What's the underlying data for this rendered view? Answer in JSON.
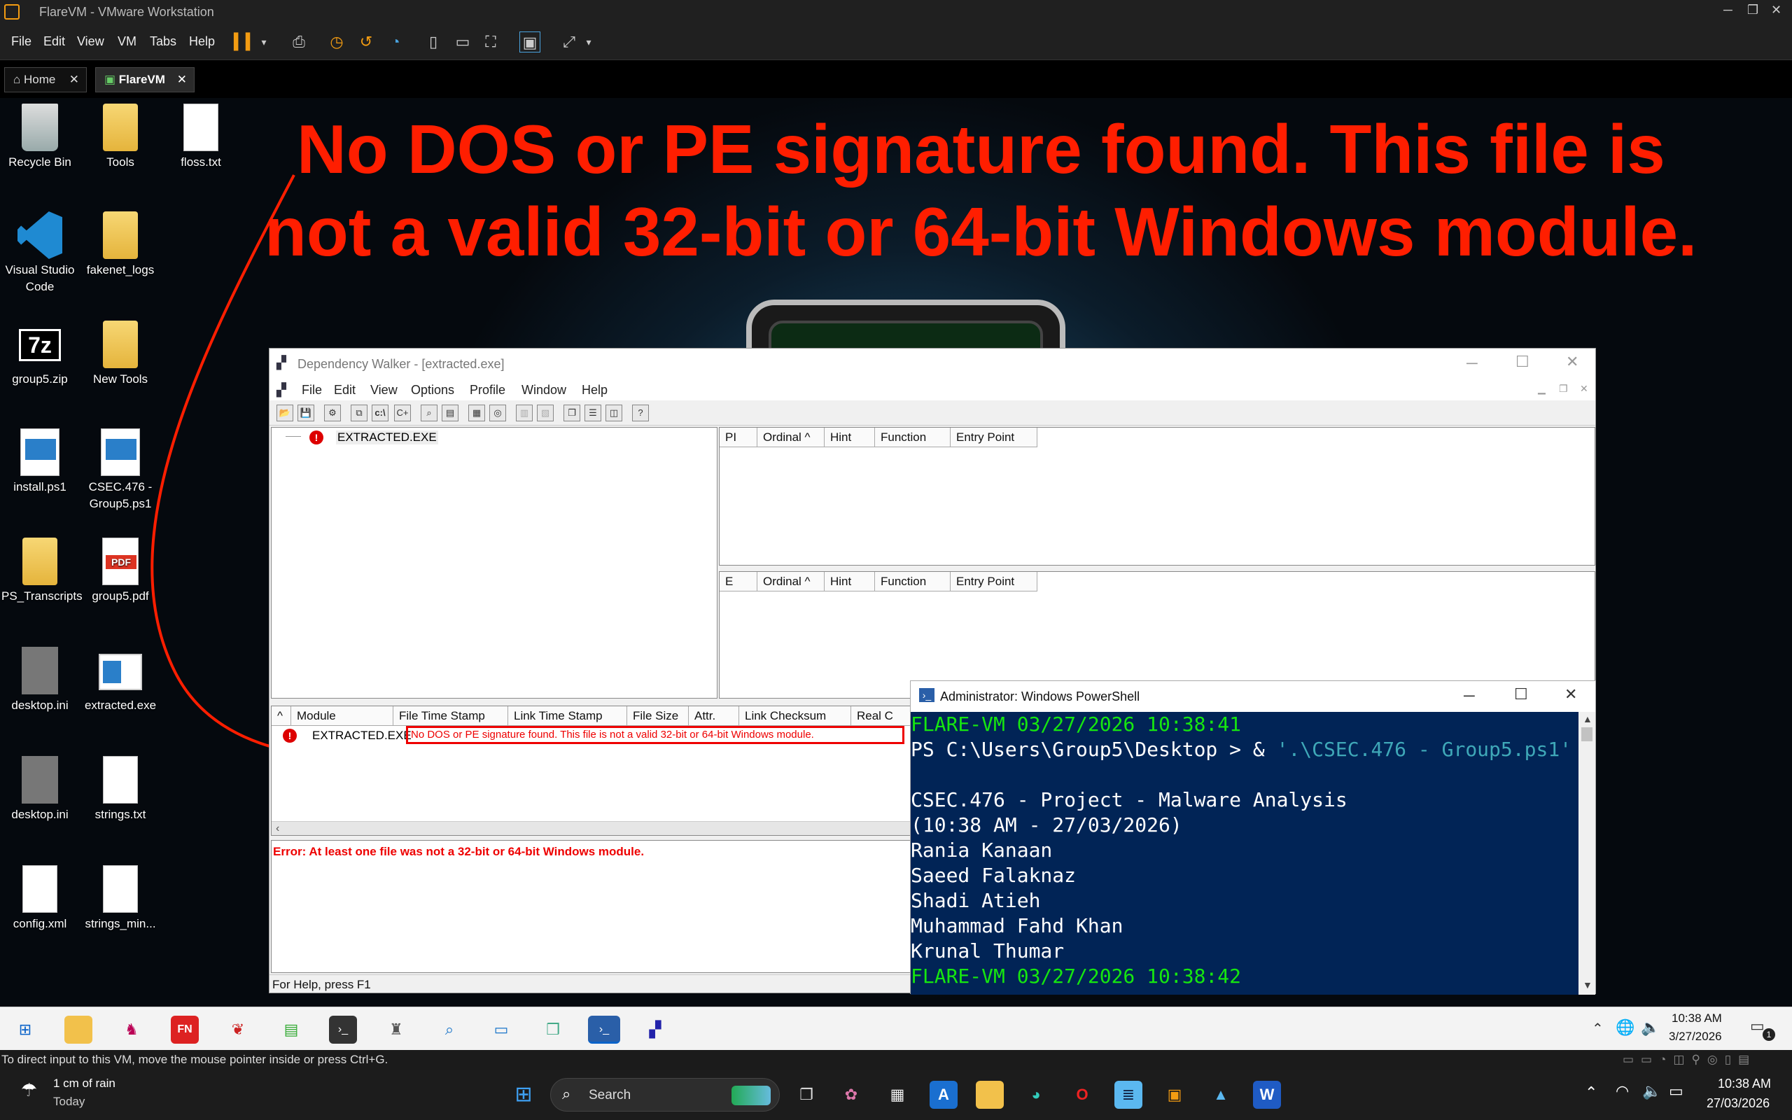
{
  "vm_window": {
    "title": "FlareVM - VMware Workstation",
    "menu": [
      "File",
      "Edit",
      "View",
      "VM",
      "Tabs",
      "Help"
    ],
    "tabs": [
      {
        "label": "Home"
      },
      {
        "label": "FlareVM"
      }
    ],
    "status_text": "To direct input to this VM, move the mouse pointer inside or press Ctrl+G."
  },
  "desktop_icons": [
    {
      "label": "Recycle Bin"
    },
    {
      "label": "Tools"
    },
    {
      "label": "floss.txt"
    },
    {
      "label": "Visual Studio Code"
    },
    {
      "label": "fakenet_logs"
    },
    {
      "label": "group5.zip"
    },
    {
      "label": "New Tools"
    },
    {
      "label": "install.ps1"
    },
    {
      "label": "CSEC.476 - Group5.ps1"
    },
    {
      "label": "PS_Transcripts"
    },
    {
      "label": "group5.pdf"
    },
    {
      "label": "desktop.ini"
    },
    {
      "label": "extracted.exe"
    },
    {
      "label": "desktop.ini"
    },
    {
      "label": "strings.txt"
    },
    {
      "label": "config.xml"
    },
    {
      "label": "strings_min..."
    }
  ],
  "annotation": {
    "line1": "No DOS or PE signature found. This file is",
    "line2": "not a valid 32-bit or 64-bit Windows module.",
    "color": "#ff1e00"
  },
  "depwalker": {
    "title": "Dependency Walker - [extracted.exe]",
    "menu": [
      "File",
      "Edit",
      "View",
      "Options",
      "Profile",
      "Window",
      "Help"
    ],
    "tree_root": "EXTRACTED.EXE",
    "import_headers": [
      "PI",
      "Ordinal ^",
      "Hint",
      "Function",
      "Entry Point"
    ],
    "export_headers": [
      "E",
      "Ordinal ^",
      "Hint",
      "Function",
      "Entry Point"
    ],
    "module_headers": [
      "^",
      "Module",
      "File Time Stamp",
      "Link Time Stamp",
      "File Size",
      "Attr.",
      "Link Checksum",
      "Real C"
    ],
    "module_row": {
      "module": "EXTRACTED.EXE",
      "message": "No DOS or PE signature found. This file is not a valid 32-bit or 64-bit Windows module."
    },
    "log_error": "Error: At least one file was not a 32-bit or 64-bit Windows module.",
    "status": "For Help, press F1",
    "toolbar_cmd": "c:\\"
  },
  "powershell": {
    "title": "Administrator: Windows PowerShell",
    "prompt_time1": "FLARE-VM 03/27/2026 10:38:41",
    "prompt_cmd": "PS C:\\Users\\Group5\\Desktop > & ",
    "prompt_arg": "'.\\CSEC.476 - Group5.ps1'",
    "output": [
      "CSEC.476 - Project - Malware Analysis",
      "(10:38 AM - 27/03/2026)",
      "Rania Kanaan",
      "Saeed Falaknaz",
      "Shadi Atieh",
      "Muhammad Fahd Khan",
      "Krunal Thumar"
    ],
    "prompt_time2": "FLARE-VM 03/27/2026 10:38:42"
  },
  "guest_taskbar": {
    "time": "10:38 AM",
    "date": "3/27/2026",
    "notifications": "1"
  },
  "host_taskbar": {
    "weather_line1": "1 cm of rain",
    "weather_line2": "Today",
    "search_label": "Search",
    "time": "10:38 AM",
    "date": "27/03/2026"
  }
}
